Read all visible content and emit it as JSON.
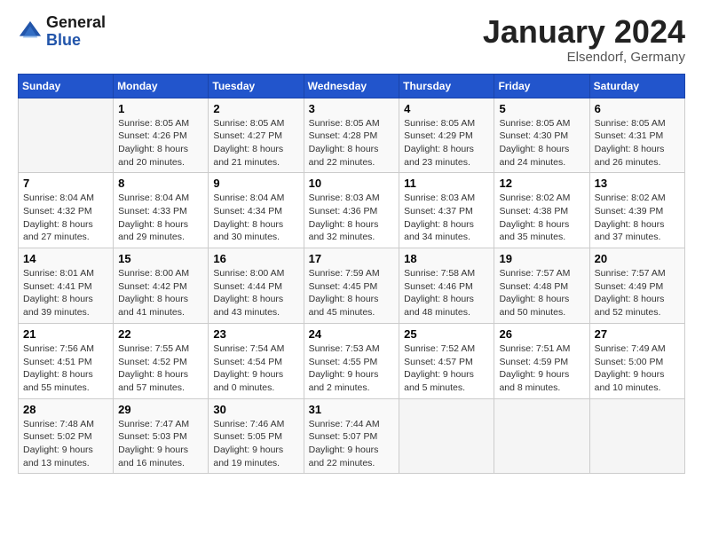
{
  "logo": {
    "general": "General",
    "blue": "Blue"
  },
  "title": "January 2024",
  "location": "Elsendorf, Germany",
  "days_of_week": [
    "Sunday",
    "Monday",
    "Tuesday",
    "Wednesday",
    "Thursday",
    "Friday",
    "Saturday"
  ],
  "weeks": [
    [
      {
        "num": "",
        "info": ""
      },
      {
        "num": "1",
        "info": "Sunrise: 8:05 AM\nSunset: 4:26 PM\nDaylight: 8 hours\nand 20 minutes."
      },
      {
        "num": "2",
        "info": "Sunrise: 8:05 AM\nSunset: 4:27 PM\nDaylight: 8 hours\nand 21 minutes."
      },
      {
        "num": "3",
        "info": "Sunrise: 8:05 AM\nSunset: 4:28 PM\nDaylight: 8 hours\nand 22 minutes."
      },
      {
        "num": "4",
        "info": "Sunrise: 8:05 AM\nSunset: 4:29 PM\nDaylight: 8 hours\nand 23 minutes."
      },
      {
        "num": "5",
        "info": "Sunrise: 8:05 AM\nSunset: 4:30 PM\nDaylight: 8 hours\nand 24 minutes."
      },
      {
        "num": "6",
        "info": "Sunrise: 8:05 AM\nSunset: 4:31 PM\nDaylight: 8 hours\nand 26 minutes."
      }
    ],
    [
      {
        "num": "7",
        "info": "Sunrise: 8:04 AM\nSunset: 4:32 PM\nDaylight: 8 hours\nand 27 minutes."
      },
      {
        "num": "8",
        "info": "Sunrise: 8:04 AM\nSunset: 4:33 PM\nDaylight: 8 hours\nand 29 minutes."
      },
      {
        "num": "9",
        "info": "Sunrise: 8:04 AM\nSunset: 4:34 PM\nDaylight: 8 hours\nand 30 minutes."
      },
      {
        "num": "10",
        "info": "Sunrise: 8:03 AM\nSunset: 4:36 PM\nDaylight: 8 hours\nand 32 minutes."
      },
      {
        "num": "11",
        "info": "Sunrise: 8:03 AM\nSunset: 4:37 PM\nDaylight: 8 hours\nand 34 minutes."
      },
      {
        "num": "12",
        "info": "Sunrise: 8:02 AM\nSunset: 4:38 PM\nDaylight: 8 hours\nand 35 minutes."
      },
      {
        "num": "13",
        "info": "Sunrise: 8:02 AM\nSunset: 4:39 PM\nDaylight: 8 hours\nand 37 minutes."
      }
    ],
    [
      {
        "num": "14",
        "info": "Sunrise: 8:01 AM\nSunset: 4:41 PM\nDaylight: 8 hours\nand 39 minutes."
      },
      {
        "num": "15",
        "info": "Sunrise: 8:00 AM\nSunset: 4:42 PM\nDaylight: 8 hours\nand 41 minutes."
      },
      {
        "num": "16",
        "info": "Sunrise: 8:00 AM\nSunset: 4:44 PM\nDaylight: 8 hours\nand 43 minutes."
      },
      {
        "num": "17",
        "info": "Sunrise: 7:59 AM\nSunset: 4:45 PM\nDaylight: 8 hours\nand 45 minutes."
      },
      {
        "num": "18",
        "info": "Sunrise: 7:58 AM\nSunset: 4:46 PM\nDaylight: 8 hours\nand 48 minutes."
      },
      {
        "num": "19",
        "info": "Sunrise: 7:57 AM\nSunset: 4:48 PM\nDaylight: 8 hours\nand 50 minutes."
      },
      {
        "num": "20",
        "info": "Sunrise: 7:57 AM\nSunset: 4:49 PM\nDaylight: 8 hours\nand 52 minutes."
      }
    ],
    [
      {
        "num": "21",
        "info": "Sunrise: 7:56 AM\nSunset: 4:51 PM\nDaylight: 8 hours\nand 55 minutes."
      },
      {
        "num": "22",
        "info": "Sunrise: 7:55 AM\nSunset: 4:52 PM\nDaylight: 8 hours\nand 57 minutes."
      },
      {
        "num": "23",
        "info": "Sunrise: 7:54 AM\nSunset: 4:54 PM\nDaylight: 9 hours\nand 0 minutes."
      },
      {
        "num": "24",
        "info": "Sunrise: 7:53 AM\nSunset: 4:55 PM\nDaylight: 9 hours\nand 2 minutes."
      },
      {
        "num": "25",
        "info": "Sunrise: 7:52 AM\nSunset: 4:57 PM\nDaylight: 9 hours\nand 5 minutes."
      },
      {
        "num": "26",
        "info": "Sunrise: 7:51 AM\nSunset: 4:59 PM\nDaylight: 9 hours\nand 8 minutes."
      },
      {
        "num": "27",
        "info": "Sunrise: 7:49 AM\nSunset: 5:00 PM\nDaylight: 9 hours\nand 10 minutes."
      }
    ],
    [
      {
        "num": "28",
        "info": "Sunrise: 7:48 AM\nSunset: 5:02 PM\nDaylight: 9 hours\nand 13 minutes."
      },
      {
        "num": "29",
        "info": "Sunrise: 7:47 AM\nSunset: 5:03 PM\nDaylight: 9 hours\nand 16 minutes."
      },
      {
        "num": "30",
        "info": "Sunrise: 7:46 AM\nSunset: 5:05 PM\nDaylight: 9 hours\nand 19 minutes."
      },
      {
        "num": "31",
        "info": "Sunrise: 7:44 AM\nSunset: 5:07 PM\nDaylight: 9 hours\nand 22 minutes."
      },
      {
        "num": "",
        "info": ""
      },
      {
        "num": "",
        "info": ""
      },
      {
        "num": "",
        "info": ""
      }
    ]
  ]
}
